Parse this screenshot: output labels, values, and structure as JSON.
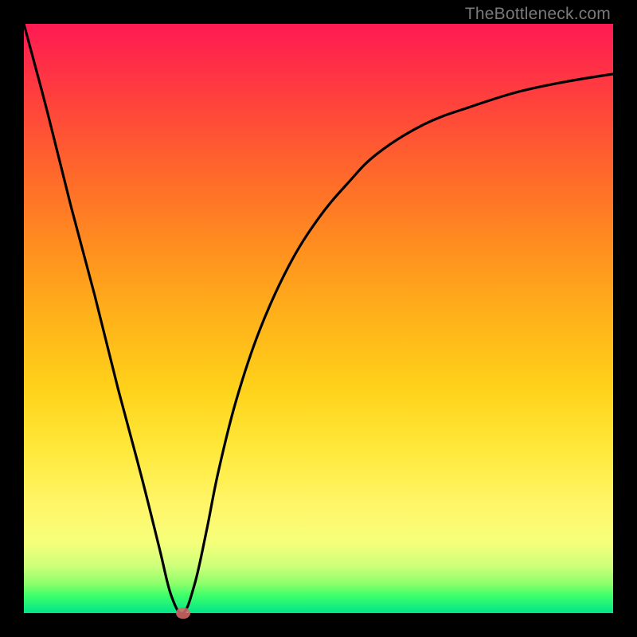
{
  "watermark": "TheBottleneck.com",
  "chart_data": {
    "type": "line",
    "title": "",
    "xlabel": "",
    "ylabel": "",
    "x_range": [
      0,
      100
    ],
    "y_range": [
      0,
      100
    ],
    "series": [
      {
        "name": "bottleneck-curve",
        "x": [
          0,
          4,
          8,
          12,
          16,
          20,
          23,
          25,
          27,
          29,
          31,
          33,
          36,
          40,
          45,
          50,
          55,
          60,
          68,
          76,
          84,
          92,
          100
        ],
        "y": [
          100,
          85,
          69,
          54,
          38,
          23,
          11,
          3,
          0,
          5,
          14,
          24,
          36,
          48,
          59,
          67,
          73,
          78,
          83,
          86,
          88.5,
          90.2,
          91.5
        ]
      }
    ],
    "marker": {
      "x": 27,
      "y": 0,
      "label": "optimal-point"
    },
    "gradient_stops": [
      {
        "pos": 0,
        "color": "#ff1a53"
      },
      {
        "pos": 50,
        "color": "#ffb21a"
      },
      {
        "pos": 82,
        "color": "#fff66a"
      },
      {
        "pos": 100,
        "color": "#00e58a"
      }
    ]
  }
}
